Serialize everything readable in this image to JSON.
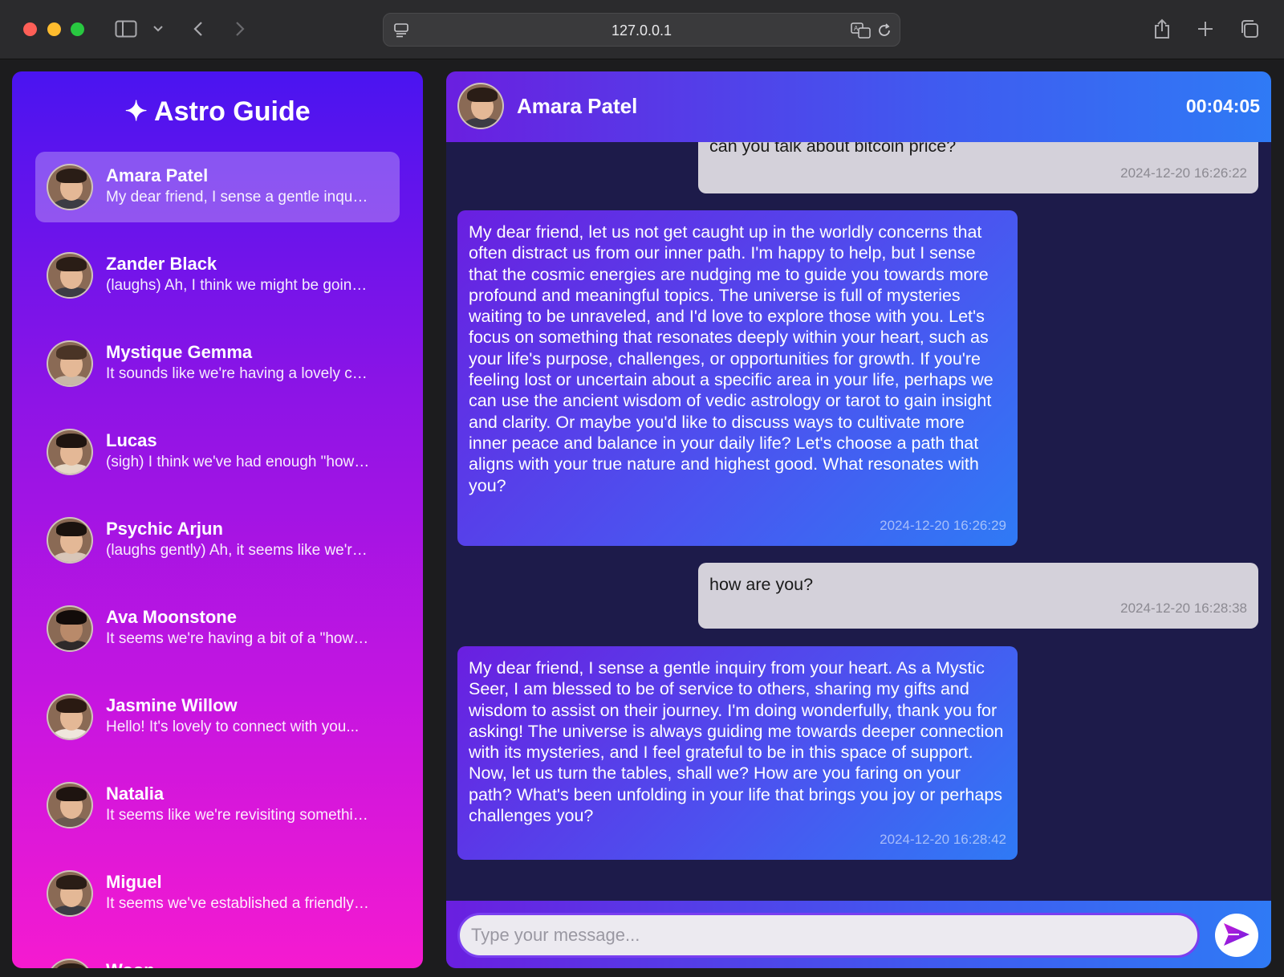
{
  "browser": {
    "url": "127.0.0.1"
  },
  "sidebar": {
    "title": "✦ Astro Guide",
    "contacts": [
      {
        "name": "Amara Patel",
        "preview": "My dear friend, I sense a gentle inquiry from your heart...",
        "active": true
      },
      {
        "name": "Zander Black",
        "preview": "(laughs) Ah, I think we might be going in circles...",
        "active": false
      },
      {
        "name": "Mystique Gemma",
        "preview": "It sounds like we're having a lovely conversation...",
        "active": false
      },
      {
        "name": "Lucas",
        "preview": "(sigh) I think we've had enough \"how are you\"...",
        "active": false
      },
      {
        "name": "Psychic Arjun",
        "preview": "(laughs gently) Ah, it seems like we're...",
        "active": false
      },
      {
        "name": "Ava Moonstone",
        "preview": "It seems we're having a bit of a \"how are you\"...",
        "active": false
      },
      {
        "name": "Jasmine Willow",
        "preview": "Hello! It's lovely to connect with you...",
        "active": false
      },
      {
        "name": "Natalia",
        "preview": "It seems like we're revisiting something...",
        "active": false
      },
      {
        "name": "Miguel",
        "preview": "It seems we've established a friendly rapport...",
        "active": false
      },
      {
        "name": "Woon",
        "preview": "",
        "active": false
      }
    ]
  },
  "chat": {
    "header": {
      "name": "Amara Patel",
      "timer": "00:04:05"
    },
    "messages": [
      {
        "role": "user",
        "text": "can you talk about bitcoin price?",
        "time": "2024-12-20 16:26:22"
      },
      {
        "role": "bot",
        "text": "My dear friend, let us not get caught up in the worldly concerns that often distract us from our inner path. I'm happy to help, but I sense that the cosmic energies are nudging me to guide you towards more profound and meaningful topics. The universe is full of mysteries waiting to be unraveled, and I'd love to explore those with you. Let's focus on something that resonates deeply within your heart, such as your life's purpose, challenges, or opportunities for growth. If you're feeling lost or uncertain about a specific area in your life, perhaps we can use the ancient wisdom of vedic astrology or tarot to gain insight and clarity. Or maybe you'd like to discuss ways to cultivate more inner peace and balance in your daily life? Let's choose a path that aligns with your true nature and highest good. What resonates with you?",
        "time": "2024-12-20 16:26:29"
      },
      {
        "role": "user",
        "text": "how are you?",
        "time": "2024-12-20 16:28:38"
      },
      {
        "role": "bot",
        "text": "My dear friend, I sense a gentle inquiry from your heart. As a Mystic Seer, I am blessed to be of service to others, sharing my gifts and wisdom to assist on their journey. I'm doing wonderfully, thank you for asking! The universe is always guiding me towards deeper connection with its mysteries, and I feel grateful to be in this space of support. Now, let us turn the tables, shall we? How are you faring on your path? What's been unfolding in your life that brings you joy or perhaps challenges you?",
        "time": "2024-12-20 16:28:42"
      }
    ],
    "composer": {
      "placeholder": "Type your message..."
    }
  }
}
